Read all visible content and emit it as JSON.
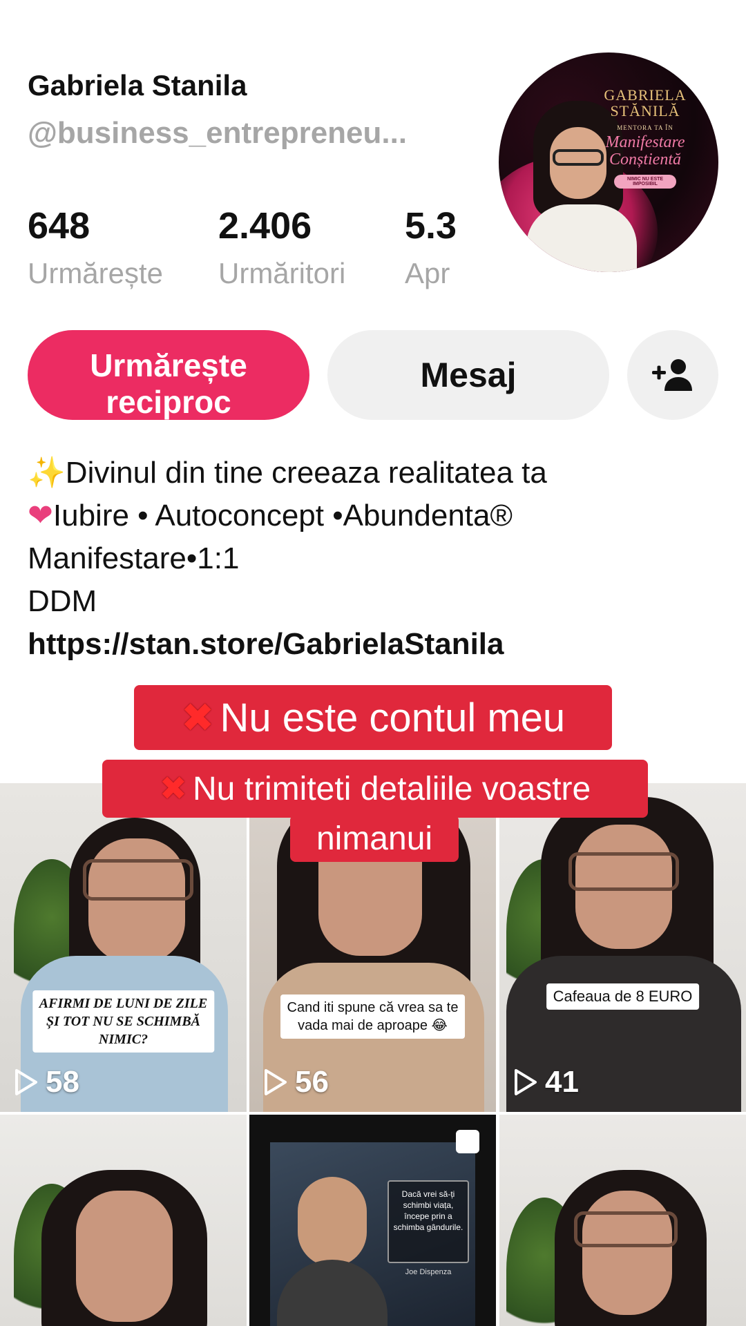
{
  "profile": {
    "name": "Gabriela Stanila",
    "handle": "@business_entrepreneu..."
  },
  "stats": [
    {
      "value": "648",
      "label": "Urmărește"
    },
    {
      "value": "2.406",
      "label": "Urmăritori"
    },
    {
      "value": "5.3",
      "label": "Apr"
    }
  ],
  "avatar": {
    "logo_title": "GABRIELA STĂNILĂ",
    "logo_subtitle": "MENTORA TA ÎN",
    "logo_script": "Manifestare Conștientă",
    "logo_pill": "NIMIC NU ESTE IMPOSIBIL"
  },
  "actions": {
    "follow_back_label": "Urmărește reciproc",
    "message_label": "Mesaj",
    "add_user_icon": "person-add-icon"
  },
  "bio": {
    "line1_emoji": "✨",
    "line1": "Divinul din tine creeaza realitatea ta",
    "line2_emoji": "❤",
    "line2": "Iubire • Autoconcept •Abundenta®",
    "line3": "Manifestare•1:1",
    "line4": "DDM",
    "link": "https://stan.store/GabrielaStanila"
  },
  "warnings": {
    "x_mark": "✖",
    "line1": "Nu este contul meu",
    "line2": "Nu trimiteti detaliile voastre",
    "line3": "nimanui"
  },
  "videos": [
    {
      "caption": "AFIRMI DE LUNI DE ZILE\nȘI TOT NU SE SCHIMBĂ\nNIMIC?",
      "views": "58"
    },
    {
      "caption": "Cand iti spune că vrea sa te\nvada mai de aproape 😂",
      "views": "56"
    },
    {
      "caption": "Cafeaua de 8 EURO",
      "views": "41"
    },
    {
      "caption": "",
      "views": ""
    },
    {
      "caption": "Dacă vrei să-ți\nschimbi viața,\nîncepe prin a\nschimba gândurile.",
      "author": "Joe Dispenza",
      "views": ""
    },
    {
      "caption": "",
      "views": ""
    }
  ],
  "colors": {
    "accent": "#ec2c62",
    "warning_bg": "#e0283c",
    "muted_text": "#a6a6a6",
    "secondary_button": "#f0f0f0"
  }
}
